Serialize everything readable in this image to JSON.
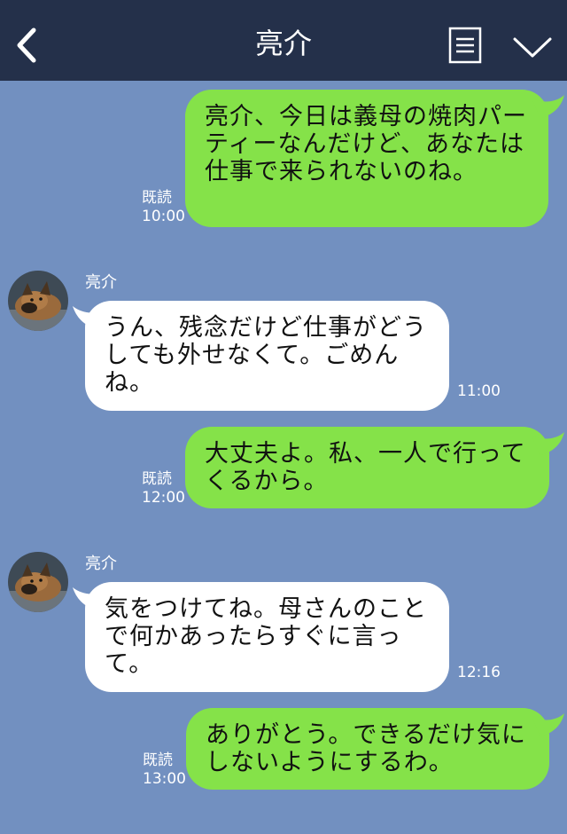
{
  "header": {
    "title": "亮介",
    "back_icon": "chevron-left-icon",
    "menu_icon": "menu-icon",
    "collapse_icon": "chevron-down-icon",
    "background": "#24304a"
  },
  "colors": {
    "chat_background": "#7290c0",
    "sent_bubble": "#85e249",
    "received_bubble": "#ffffff"
  },
  "messages": [
    {
      "direction": "sent",
      "text": "亮介、今日は義母の焼肉パーティーなんだけど、あなたは仕事で来られないのね。",
      "read_label": "既読",
      "time": "10:00"
    },
    {
      "direction": "received",
      "sender": "亮介",
      "avatar": "dog-avatar",
      "text": "うん、残念だけど仕事がどうしても外せなくて。ごめんね。",
      "time": "11:00"
    },
    {
      "direction": "sent",
      "text": "大丈夫よ。私、一人で行ってくるから。",
      "read_label": "既読",
      "time": "12:00"
    },
    {
      "direction": "received",
      "sender": "亮介",
      "avatar": "dog-avatar",
      "text": "気をつけてね。母さんのことで何かあったらすぐに言って。",
      "time": "12:16"
    },
    {
      "direction": "sent",
      "text": "ありがとう。できるだけ気にしないようにするわ。",
      "read_label": "既読",
      "time": "13:00"
    }
  ]
}
